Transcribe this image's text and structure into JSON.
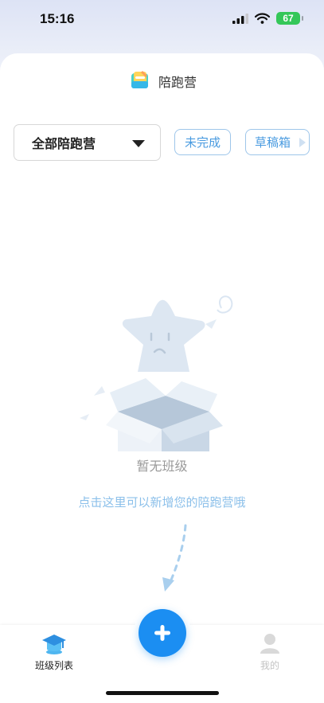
{
  "status_bar": {
    "time": "15:16",
    "battery": "67"
  },
  "header": {
    "title": "陪跑营",
    "logo_icon": "camp-book-icon"
  },
  "filters": {
    "dropdown_label": "全部陪跑营",
    "unfinished_label": "未完成",
    "drafts_label": "草稿箱"
  },
  "empty_state": {
    "illustration": "empty-box-star-illustration",
    "message": "暂无班级",
    "hint": "点击这里可以新增您的陪跑营哦"
  },
  "tabbar": {
    "classes_label": "班级列表",
    "mine_label": "我的",
    "add_icon": "plus-icon"
  },
  "colors": {
    "accent": "#1b8ef2",
    "link": "#8cc0ea",
    "battery": "#34c759"
  }
}
